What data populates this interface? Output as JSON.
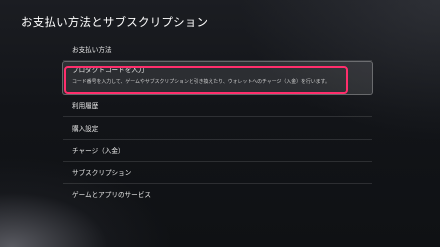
{
  "page": {
    "title": "お支払い方法とサブスクリプション"
  },
  "menu": {
    "items": [
      {
        "label": "お支払い方法"
      },
      {
        "label": "プロダクトコードを入力",
        "description": "コード番号を入力して、ゲームやサブスクリプションと引き換えたり、ウォレットへのチャージ（入金）を行います。"
      },
      {
        "label": "利用履歴"
      },
      {
        "label": "購入設定"
      },
      {
        "label": "チャージ（入金）"
      },
      {
        "label": "サブスクリプション"
      },
      {
        "label": "ゲームとアプリのサービス"
      }
    ],
    "selected_index": 1
  },
  "colors": {
    "highlight": "#ff2e6c",
    "background": "#121418"
  }
}
